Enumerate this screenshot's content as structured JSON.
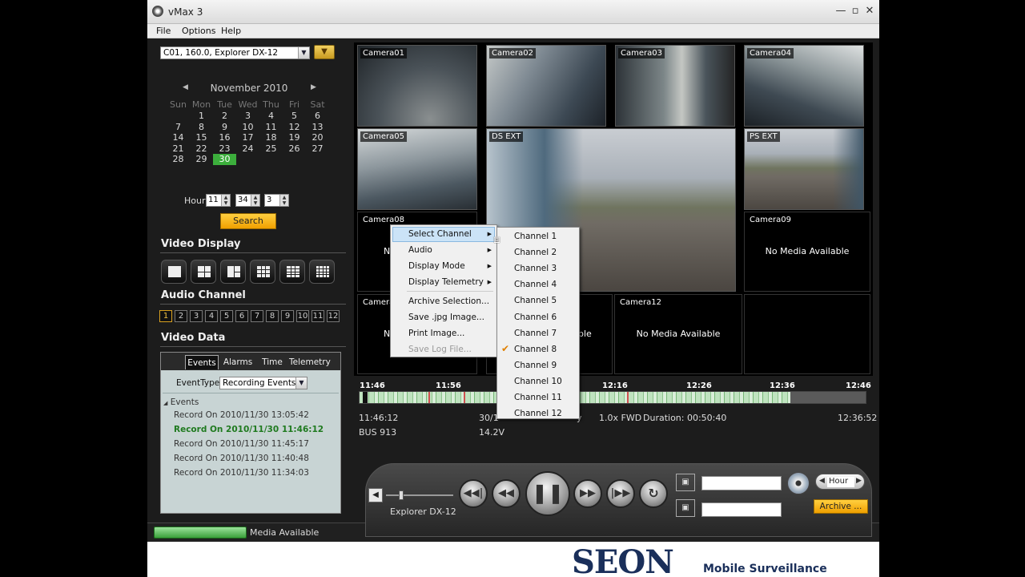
{
  "window": {
    "title": "vMax 3"
  },
  "menubar": [
    "File",
    "Options",
    "Help"
  ],
  "device_select": "C01, 160.0, Explorer DX-12",
  "calendar": {
    "month": "November 2010",
    "weekdays": [
      "Sun",
      "Mon",
      "Tue",
      "Wed",
      "Thu",
      "Fri",
      "Sat"
    ],
    "weeks": [
      [
        "",
        "1",
        "2",
        "3",
        "4",
        "5",
        "6"
      ],
      [
        "7",
        "8",
        "9",
        "10",
        "11",
        "12",
        "13"
      ],
      [
        "14",
        "15",
        "16",
        "17",
        "18",
        "19",
        "20"
      ],
      [
        "21",
        "22",
        "23",
        "24",
        "25",
        "26",
        "27"
      ],
      [
        "28",
        "29",
        "30",
        "",
        "",
        "",
        ""
      ]
    ],
    "selected": "30"
  },
  "time": {
    "label": "Hour",
    "hour": "11",
    "minute": "34",
    "second": "3"
  },
  "search_label": "Search",
  "sections": {
    "video_display": "Video Display",
    "audio_channel": "Audio Channel",
    "video_data": "Video Data"
  },
  "audio_channels": [
    "1",
    "2",
    "3",
    "4",
    "5",
    "6",
    "7",
    "8",
    "9",
    "10",
    "11",
    "12"
  ],
  "audio_selected": "1",
  "video_data": {
    "tabs": [
      "Events",
      "Alarms",
      "Time",
      "Telemetry"
    ],
    "active_tab": "Events",
    "event_type_label": "EventType:",
    "event_type_value": "Recording Events",
    "tree_root": "Events",
    "events": [
      "Record On 2010/11/30 13:05:42",
      "Record On 2010/11/30 11:46:12",
      "Record On 2010/11/30 11:45:17",
      "Record On 2010/11/30 11:40:48",
      "Record On 2010/11/30 11:34:03"
    ],
    "highlighted_event": 1
  },
  "cameras": {
    "cam01": "Camera01",
    "cam02": "Camera02",
    "cam03": "Camera03",
    "cam04": "Camera04",
    "cam05": "Camera05",
    "ds_ext": "DS EXT",
    "ps_ext": "PS EXT",
    "cam08": "Camera08",
    "cam09": "Camera09",
    "cam10": "Camera",
    "cam12": "Camera12",
    "no_media": "No Media Available",
    "no_media_partial_a": "No",
    "no_media_partial_b": "No",
    "no_media_partial_c": "ble"
  },
  "timeline": {
    "ticks": [
      "11:46",
      "11:56",
      "12:16",
      "12:26",
      "12:36",
      "12:46"
    ]
  },
  "info": {
    "time_current": "11:46:12",
    "date_partial": "30/1",
    "speed_partial": "y",
    "playback": "1.0x FWD",
    "duration": "Duration: 00:50:40",
    "time_end": "12:36:52",
    "bus": "BUS 913",
    "voltage": "14.2V"
  },
  "context_menu": {
    "items": [
      "Select Channel",
      "Audio",
      "Display Mode",
      "Display Telemetry",
      "Archive Selection...",
      "Save .jpg Image...",
      "Print Image...",
      "Save Log File..."
    ]
  },
  "channel_submenu": {
    "items": [
      "Channel 1",
      "Channel 2",
      "Channel 3",
      "Channel 4",
      "Channel 5",
      "Channel 6",
      "Channel 7",
      "Channel 8",
      "Channel 9",
      "Channel 10",
      "Channel 11",
      "Channel 12"
    ],
    "checked": "Channel 8"
  },
  "controls": {
    "device_name": "Explorer DX-12",
    "range_unit": "Hour",
    "archive_label": "Archive ..."
  },
  "status": {
    "text": "Media Available"
  },
  "footer": {
    "brand": "SEON",
    "tagline": "Mobile Surveillance"
  }
}
